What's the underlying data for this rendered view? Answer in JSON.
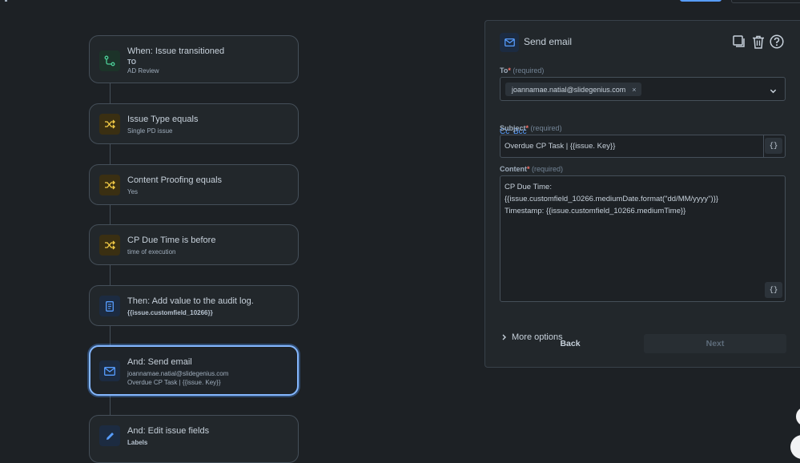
{
  "flow": {
    "steps": [
      {
        "title": "When: Issue transitioned",
        "line1": "TO",
        "line2": "AD Review",
        "icon": "branch-icon"
      },
      {
        "title": "Issue Type equals",
        "line1": "Single PD issue",
        "icon": "shuffle-icon"
      },
      {
        "title": "Content Proofing equals",
        "line1": "Yes",
        "icon": "shuffle-icon"
      },
      {
        "title": "CP Due Time is before",
        "line1": "time of execution",
        "icon": "shuffle-icon"
      },
      {
        "title": "Then: Add value to the audit log.",
        "line1": "{{issue.customfield_10266}}",
        "icon": "document-icon"
      },
      {
        "title": "And: Send email",
        "line1": "joannamae.natial@slidegenius.com",
        "line2": "Overdue CP Task | {{issue. Key}}",
        "icon": "mail-icon"
      },
      {
        "title": "And: Edit issue fields",
        "line1": "Labels",
        "icon": "pencil-icon"
      }
    ]
  },
  "panel": {
    "title": "Send email",
    "to": {
      "label": "To",
      "required": "(required)",
      "recipient": "joannamae.natial@slidegenius.com",
      "remove": "×"
    },
    "cc_label": "Cc",
    "bcc_label": "Bcc",
    "subject": {
      "label": "Subject",
      "required": "(required)",
      "value": "Overdue CP Task | {{issue. Key}}"
    },
    "content": {
      "label": "Content",
      "required": "(required)",
      "lines": [
        "CP Due Time:",
        "{{issue.customfield_10266.mediumDate.format(\"dd/MM/yyyy\")}}",
        "Timestamp: {{issue.customfield_10266.mediumTime}}"
      ]
    },
    "brace": "{}",
    "star": "*",
    "more_options": "More options",
    "back": "Back",
    "next": "Next"
  },
  "colors": {
    "accent": "#579dff",
    "selected_border": "#85b8ff",
    "required_star": "#f87168"
  }
}
